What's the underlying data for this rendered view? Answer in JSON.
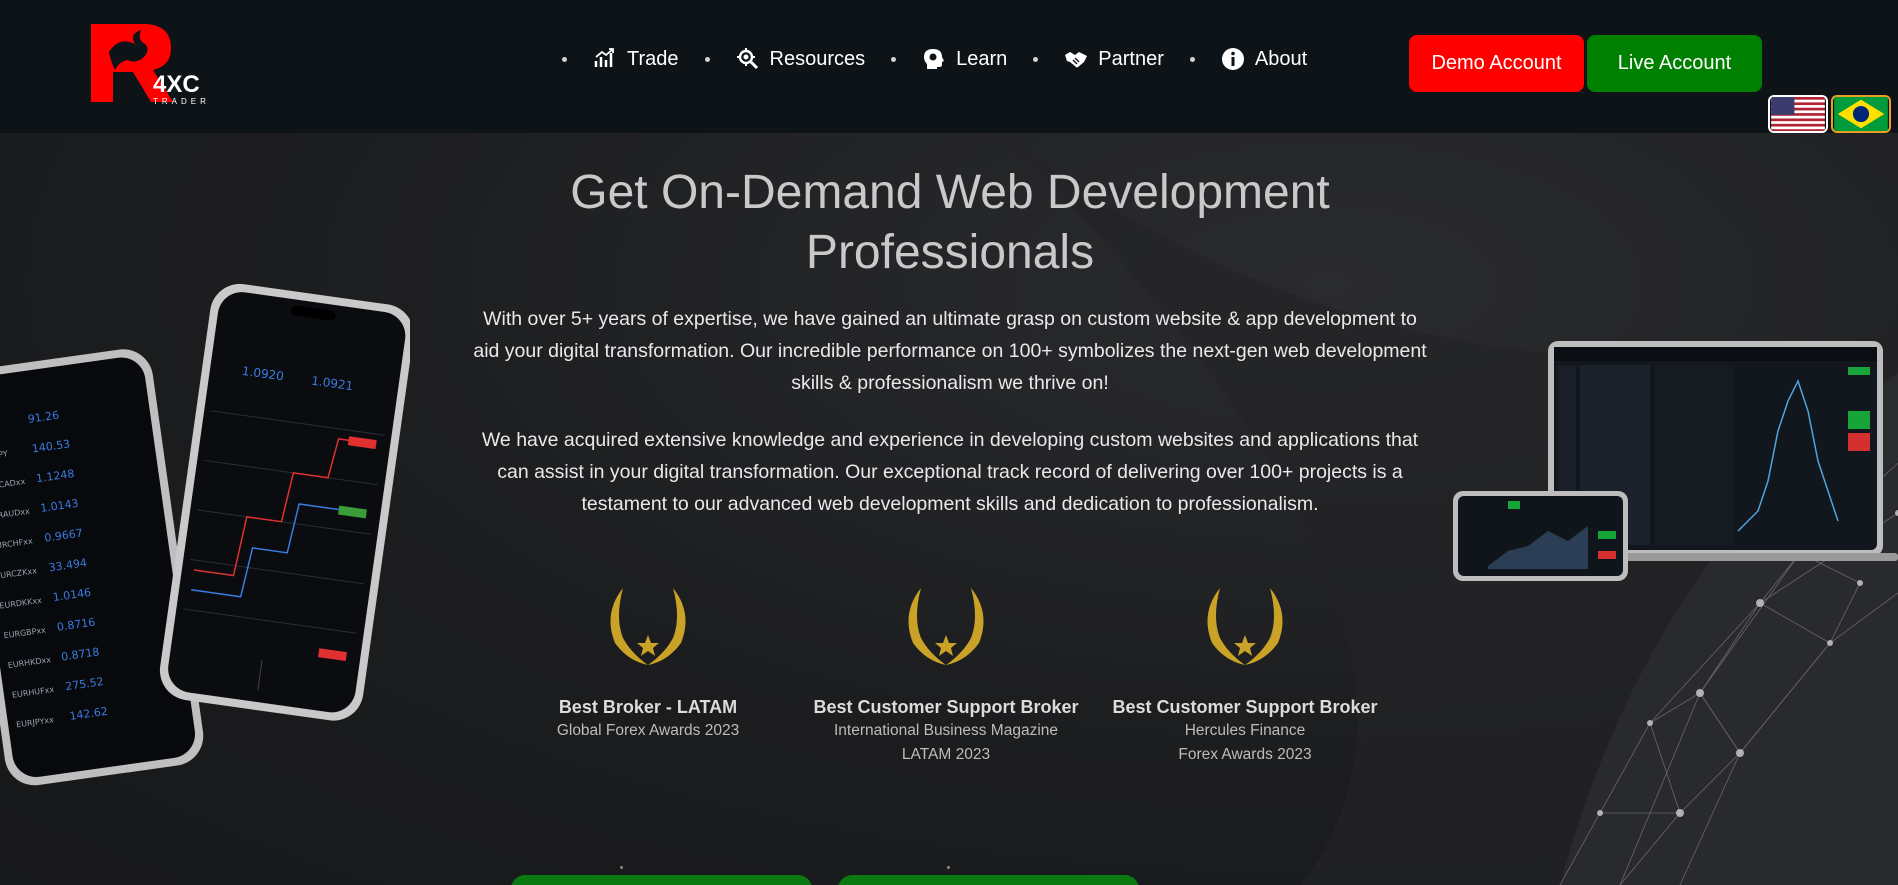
{
  "header": {
    "logo": {
      "text": "4XC",
      "subtext": "TRADER",
      "accent": "#ff0000"
    },
    "nav": [
      {
        "label": "Trade",
        "icon": "chart-trend-icon"
      },
      {
        "label": "Resources",
        "icon": "gear-search-icon"
      },
      {
        "label": "Learn",
        "icon": "head-brain-icon"
      },
      {
        "label": "Partner",
        "icon": "handshake-icon"
      },
      {
        "label": "About",
        "icon": "info-icon"
      }
    ],
    "demo_button": "Demo Account",
    "live_button": "Live Account",
    "colors": {
      "demo": "#ff0000",
      "live": "#008000",
      "header_bg": "#0e1318"
    },
    "flags": [
      "us-flag-icon",
      "brazil-flag-icon"
    ]
  },
  "hero": {
    "title_line1": "Get On-Demand Web Development",
    "title_line2": "Professionals",
    "paragraph1": "With over 5+ years of expertise, we have gained an ultimate grasp on custom website & app development to aid your digital transformation. Our incredible performance on 100+ symbolizes the next-gen web development skills & professionalism we thrive on!",
    "paragraph2": "We have acquired extensive knowledge and experience in developing custom websites and applications that can assist in your digital transformation. Our exceptional track record of delivering over 100+ projects is a testament to our advanced web development skills and dedication to professionalism."
  },
  "awards": [
    {
      "title": "Best Broker - LATAM",
      "line1": "Global Forex Awards 2023",
      "line2": ""
    },
    {
      "title": "Best Customer Support Broker",
      "line1": "International Business Magazine",
      "line2": "LATAM 2023"
    },
    {
      "title": "Best Customer Support Broker",
      "line1": "Hercules Finance",
      "line2": "Forex Awards 2023"
    }
  ],
  "award_color": "#c9a227"
}
